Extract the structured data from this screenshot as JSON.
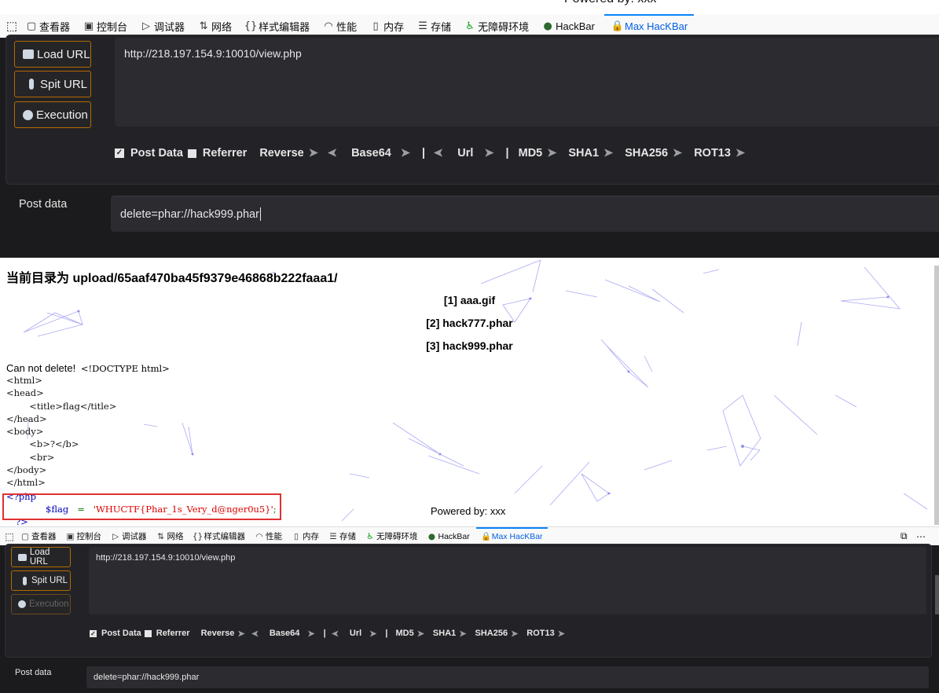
{
  "devtools": {
    "tabs": [
      {
        "label": "查看器",
        "icon": "inspector-icon"
      },
      {
        "label": "控制台",
        "icon": "console-icon"
      },
      {
        "label": "调试器",
        "icon": "debugger-icon"
      },
      {
        "label": "网络",
        "icon": "network-icon"
      },
      {
        "label": "样式编辑器",
        "icon": "style-editor-icon"
      },
      {
        "label": "性能",
        "icon": "performance-icon"
      },
      {
        "label": "内存",
        "icon": "memory-icon"
      },
      {
        "label": "存储",
        "icon": "storage-icon"
      },
      {
        "label": "无障碍环境",
        "icon": "accessibility-icon"
      },
      {
        "label": "HackBar",
        "icon": "hackbar-icon"
      },
      {
        "label": "Max HacKBar",
        "icon": "max-hackbar-icon"
      }
    ]
  },
  "top_overlay_text": "Powered by: xxx",
  "hackbar": {
    "load_url": "Load URL",
    "split_url": "Spit URL",
    "execution": "Execution",
    "url_value": "http://218.197.154.9:10010/view.php",
    "options": {
      "post_data": "Post Data",
      "referrer": "Referrer",
      "reverse": "Reverse",
      "base64": "Base64",
      "sep": "|",
      "url": "Url",
      "md5": "MD5",
      "sha1": "SHA1",
      "sha256": "SHA256",
      "rot13": "ROT13"
    },
    "post_label": "Post data",
    "post_value": "delete=phar://hack999.phar"
  },
  "page": {
    "directory": "当前目录为 upload/65aaf470ba45f9379e46868b222faaa1/",
    "files": [
      "[1] aaa.gif",
      "[2] hack777.phar",
      "[3] hack999.phar"
    ],
    "cannot_delete": "Can not delete!",
    "source_first": "<!DOCTYPE  html>",
    "source_lines": "<html>\n<head>\n        <title>flag</title>\n</head>\n<body>\n        <b>?</b>\n        <br>\n</body>\n</html>",
    "php_open": "<?php",
    "flag_var": "$flag",
    "flag_eq": "=",
    "flag_value": "'WHUCTF{Phar_1s_Very_d@nger0u5}'",
    "flag_end": ";",
    "php_close": "?>",
    "powered": "Powered by: xxx"
  },
  "colors": {
    "accent": "#0a84ff",
    "button_border": "#b36b00",
    "flag_highlight": "#e03030",
    "php_tag": "#0000bb",
    "php_string": "#dd0000"
  }
}
